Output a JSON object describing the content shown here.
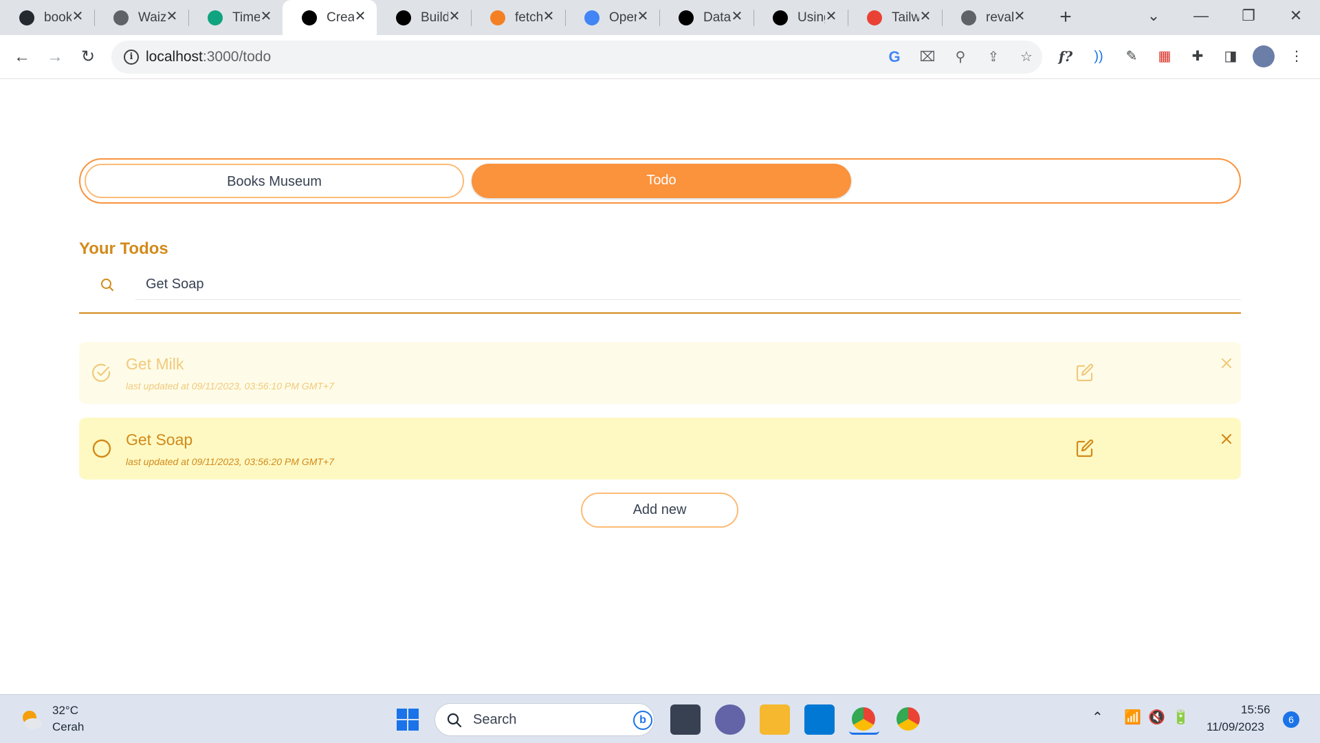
{
  "browser": {
    "tabs": [
      {
        "title": "book",
        "icon": "github-icon",
        "color": "#24292f"
      },
      {
        "title": "Waiz",
        "icon": "globe-icon",
        "color": "#5f6368"
      },
      {
        "title": "Time",
        "icon": "chatgpt-icon",
        "color": "#10a37f"
      },
      {
        "title": "Creat",
        "icon": "vercel-icon",
        "color": "#000000"
      },
      {
        "title": "Build",
        "icon": "nextjs-icon",
        "color": "#000000"
      },
      {
        "title": "fetch",
        "icon": "stackoverflow-icon",
        "color": "#f48024"
      },
      {
        "title": "Oper",
        "icon": "docs-icon",
        "color": "#4285f4"
      },
      {
        "title": "Data",
        "icon": "nextjs-icon",
        "color": "#000000"
      },
      {
        "title": "Using",
        "icon": "medium-icon",
        "color": "#000000"
      },
      {
        "title": "Tailw",
        "icon": "colorful-icon",
        "color": "#e94235"
      },
      {
        "title": "reval",
        "icon": "globe-icon",
        "color": "#5f6368"
      }
    ],
    "active_tab_index": 3,
    "url": "localhost:3000/todo",
    "url_host": "localhost",
    "url_path": ":3000/todo"
  },
  "app": {
    "nav": {
      "books_label": "Books Museum",
      "todo_label": "Todo",
      "active": "Todo"
    },
    "heading": "Your Todos",
    "search": {
      "value": "Get Soap"
    },
    "todos": [
      {
        "name": "Get Milk",
        "meta": "last updated at 09/11/2023, 03:56:10 PM GMT+7",
        "completed": true
      },
      {
        "name": "Get Soap",
        "meta": "last updated at 09/11/2023, 03:56:20 PM GMT+7",
        "completed": false
      }
    ],
    "add_button_label": "Add new",
    "colors": {
      "accent": "#fb923c",
      "accent_light": "#fdba74",
      "title": "#d28a1a",
      "done_bg": "#fefce8",
      "open_bg": "#fef9c3"
    }
  },
  "taskbar": {
    "temperature": "32°C",
    "condition": "Cerah",
    "search_placeholder": "Search",
    "time": "15:56",
    "date": "11/09/2023",
    "notification_count": "6"
  }
}
